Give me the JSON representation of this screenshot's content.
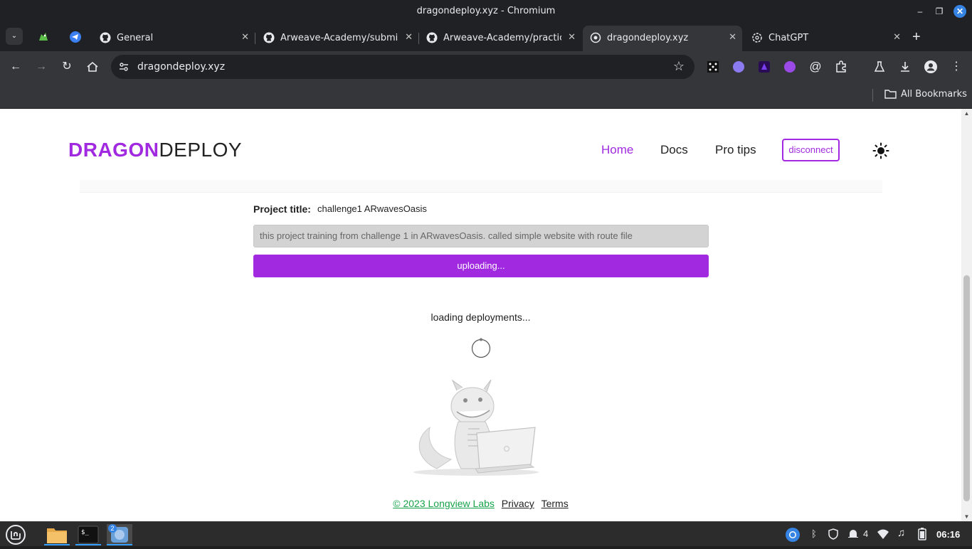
{
  "window": {
    "title": "dragondeploy.xyz - Chromium"
  },
  "tabs": [
    {
      "label": "General",
      "favicon": "github-icon"
    },
    {
      "label": "Arweave-Academy/submiss",
      "favicon": "github-icon"
    },
    {
      "label": "Arweave-Academy/practice",
      "favicon": "github-icon"
    },
    {
      "label": "dragondeploy.xyz",
      "favicon": "globe-icon",
      "active": true
    },
    {
      "label": "ChatGPT",
      "favicon": "openai-icon"
    }
  ],
  "address_bar": {
    "url": "dragondeploy.xyz"
  },
  "bookmarks": {
    "folder_label": "All Bookmarks"
  },
  "site": {
    "logo_primary": "DRAGON",
    "logo_secondary": "DEPLOY",
    "nav": {
      "home": "Home",
      "docs": "Docs",
      "pro_tips": "Pro tips",
      "disconnect": "disconnect"
    },
    "accent_color": "#a12ae0"
  },
  "project": {
    "title_label": "Project title:",
    "title_value": "challenge1 ARwavesOasis",
    "description": "this project training from challenge 1 in ARwavesOasis. called simple website with route file",
    "upload_button": "uploading..."
  },
  "deployments": {
    "status": "loading deployments..."
  },
  "footer": {
    "copyright": "© 2023 Longview Labs",
    "privacy": "Privacy",
    "terms": "Terms"
  },
  "taskbar": {
    "browser_badge": "2",
    "notification_count": "4",
    "clock": "06:16"
  }
}
